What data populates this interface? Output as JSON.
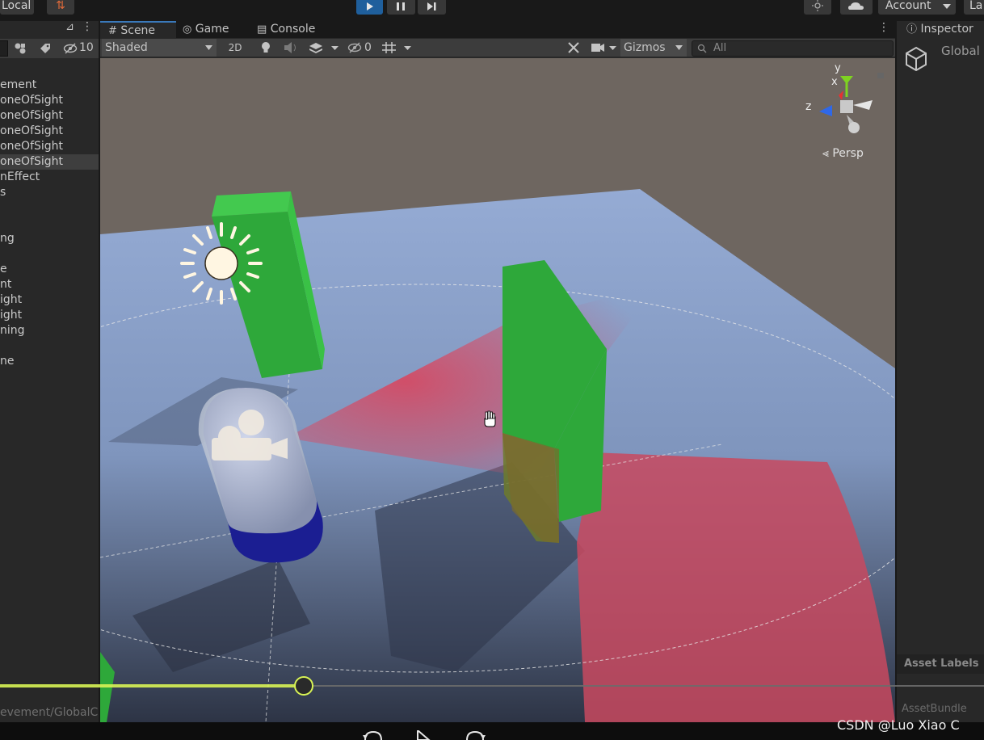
{
  "toolbar": {
    "local_label": "Local",
    "account_label": "Account",
    "layers_label": "La"
  },
  "hierarchy": {
    "items": [
      {
        "label": "ement",
        "selected": false
      },
      {
        "label": "oneOfSight",
        "selected": false
      },
      {
        "label": "oneOfSight",
        "selected": false
      },
      {
        "label": "oneOfSight",
        "selected": false
      },
      {
        "label": "oneOfSight",
        "selected": false
      },
      {
        "label": "oneOfSight",
        "selected": true
      },
      {
        "label": "nEffect",
        "selected": false
      },
      {
        "label": "s",
        "selected": false
      },
      {
        "label": "",
        "selected": false
      },
      {
        "label": "",
        "selected": false
      },
      {
        "label": "ng",
        "selected": false
      },
      {
        "label": "",
        "selected": false
      },
      {
        "label": "e",
        "selected": false
      },
      {
        "label": "nt",
        "selected": false
      },
      {
        "label": "ight",
        "selected": false
      },
      {
        "label": "ight",
        "selected": false
      },
      {
        "label": "ning",
        "selected": false
      },
      {
        "label": "",
        "selected": false
      },
      {
        "label": "ne",
        "selected": false
      }
    ],
    "hidden_count": "10",
    "path_text": "evement/GlobalCo"
  },
  "scene": {
    "tabs": [
      "Scene",
      "Game",
      "Console"
    ],
    "shading_mode": "Shaded",
    "mode_2d": "2D",
    "hidden_layers_count": "0",
    "gizmos_label": "Gizmos",
    "search_placeholder": "All",
    "projection_label": "Persp",
    "axis_labels": {
      "x": "x",
      "y": "y",
      "z": "z"
    }
  },
  "inspector": {
    "tab_label": "Inspector",
    "object_name": "Global",
    "asset_labels": "Asset Labels",
    "asset_bundle": "AssetBundle"
  },
  "slider": {
    "value": 0.309
  },
  "watermark": "CSDN @Luo Xiao C",
  "colors": {
    "accent_blue": "#1f5f9c",
    "slider_fill": "#d8f355",
    "ground": "#8fa6cf",
    "backdrop": "#6e6660",
    "cube_green": "#2fa83a",
    "sight_red": "#e03a4c",
    "capsule_blue": "#1a1a96"
  }
}
